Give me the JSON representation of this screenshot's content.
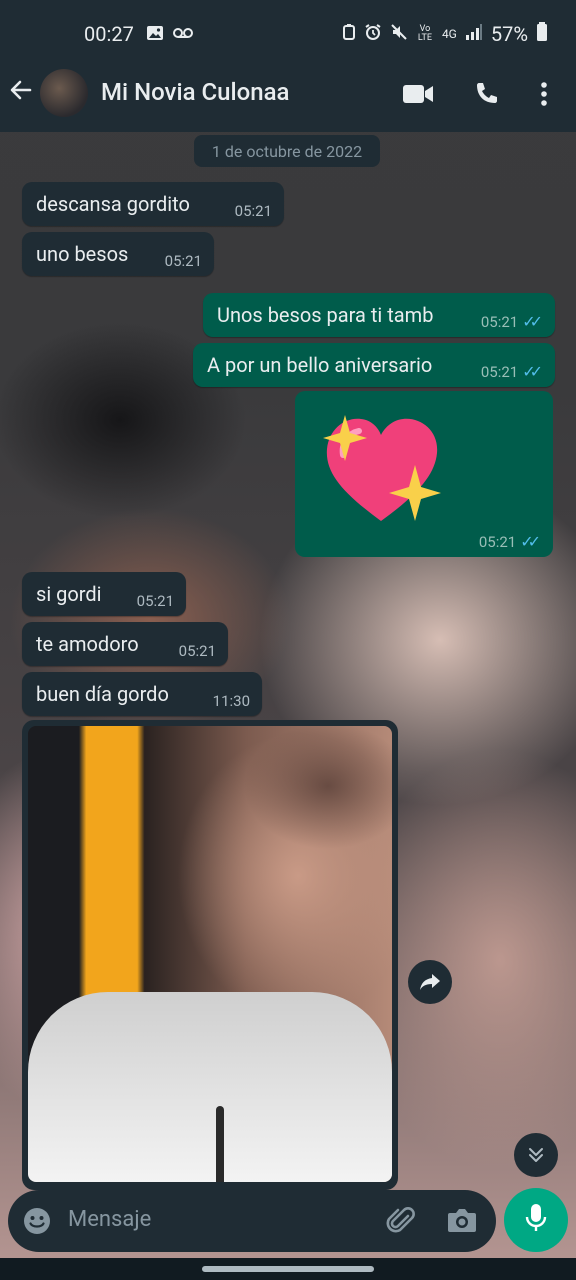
{
  "status": {
    "time": "00:27",
    "left_icons": [
      "image-icon",
      "voicemail-icon"
    ],
    "right_icons": [
      "data-saver-icon",
      "alarm-icon",
      "mute-icon",
      "volte-icon",
      "4g-icon",
      "signal-icon"
    ],
    "volte": "Vo LTE",
    "network": "4G",
    "battery": "57%"
  },
  "header": {
    "title": "Mi Novia Culonaa"
  },
  "date_chip": "1 de octubre de 2022",
  "messages": [
    {
      "dir": "in",
      "text": "descansa gordito",
      "time": "05:21"
    },
    {
      "dir": "in",
      "text": "uno besos",
      "time": "05:21"
    },
    {
      "dir": "out",
      "text": "Unos besos para ti tamb",
      "time": "05:21",
      "read": true
    },
    {
      "dir": "out",
      "text": "A por un bello aniversario",
      "time": "05:21",
      "read": true
    },
    {
      "dir": "out",
      "type": "sticker",
      "sticker": "sparkling-heart",
      "time": "05:21",
      "read": true
    },
    {
      "dir": "in",
      "text": "si gordi",
      "time": "05:21"
    },
    {
      "dir": "in",
      "text": "te amodoro",
      "time": "05:21"
    },
    {
      "dir": "in",
      "text": "buen día gordo",
      "time": "11:30"
    },
    {
      "dir": "in",
      "type": "image"
    }
  ],
  "input": {
    "placeholder": "Mensaje"
  },
  "colors": {
    "header_bg": "#1f2c34",
    "incoming_bubble": "#1f2c34",
    "outgoing_bubble": "#005c4b",
    "accent": "#00a884",
    "read_ticks": "#53bdeb"
  }
}
